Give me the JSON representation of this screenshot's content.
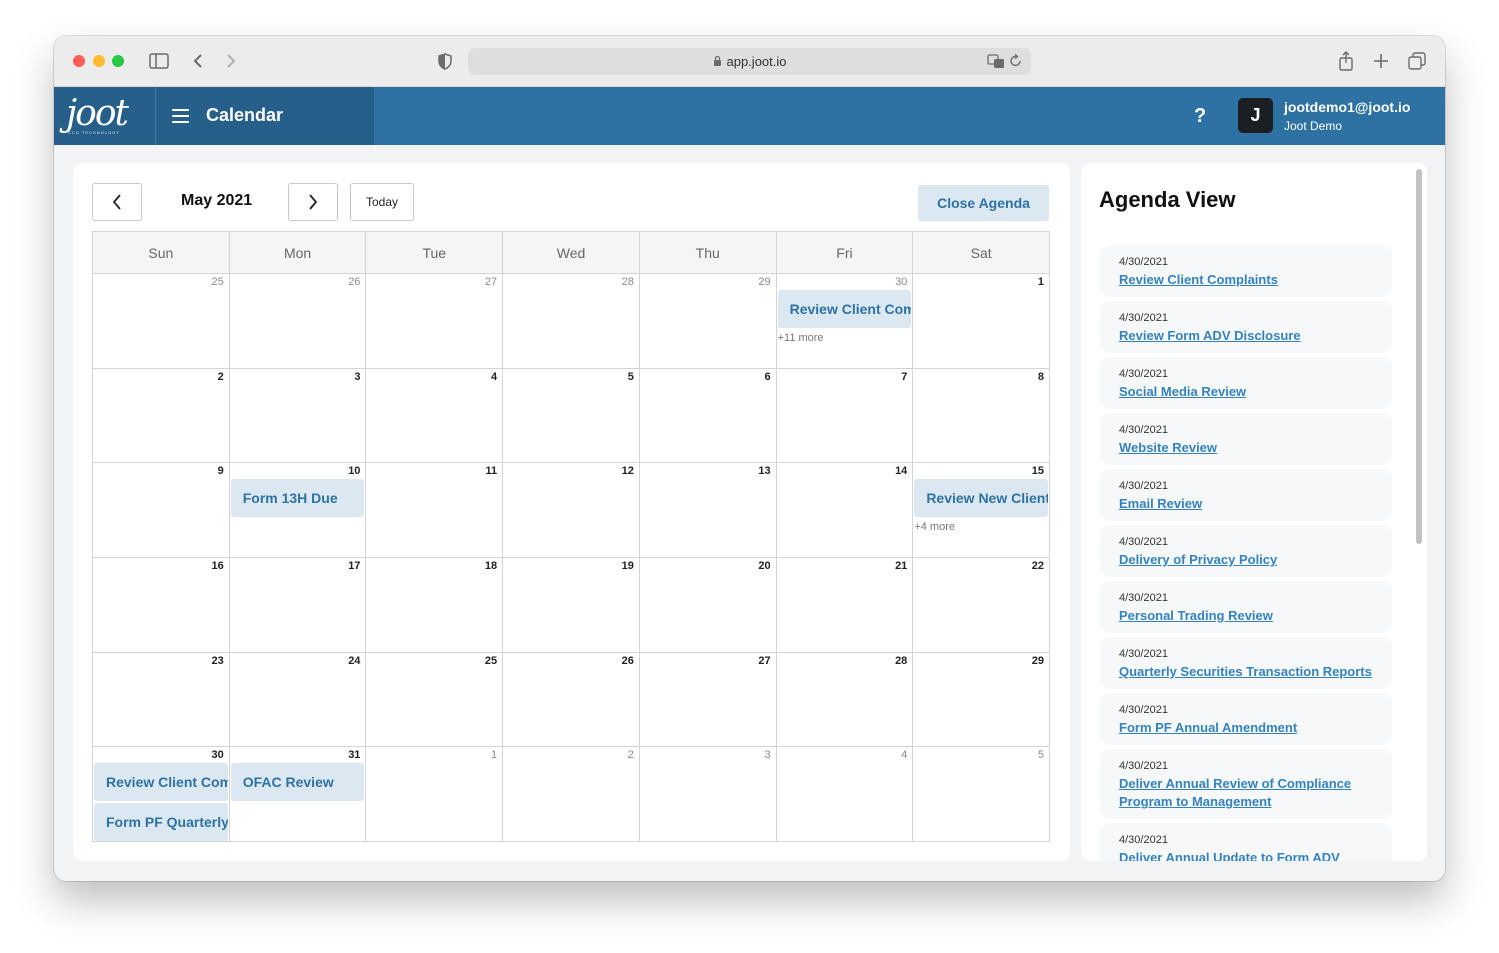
{
  "browser": {
    "url": "app.joot.io"
  },
  "header": {
    "logo_text": "joot",
    "logo_subtext": "CCO TECHNOLOGY",
    "title": "Calendar",
    "help_label": "?",
    "avatar_initial": "J",
    "user_email": "jootdemo1@joot.io",
    "user_name": "Joot Demo"
  },
  "calendar": {
    "month_label": "May 2021",
    "prev_label": "‹",
    "next_label": "›",
    "today_label": "Today",
    "close_agenda_label": "Close Agenda",
    "weekdays": [
      "Sun",
      "Mon",
      "Tue",
      "Wed",
      "Thu",
      "Fri",
      "Sat"
    ],
    "weeks": [
      [
        {
          "num": "25",
          "other": true
        },
        {
          "num": "26",
          "other": true
        },
        {
          "num": "27",
          "other": true
        },
        {
          "num": "28",
          "other": true
        },
        {
          "num": "29",
          "other": true
        },
        {
          "num": "30",
          "other": true,
          "events": [
            "Review Client Complaints"
          ],
          "more": "+11 more"
        },
        {
          "num": "1"
        }
      ],
      [
        {
          "num": "2"
        },
        {
          "num": "3"
        },
        {
          "num": "4"
        },
        {
          "num": "5"
        },
        {
          "num": "6"
        },
        {
          "num": "7"
        },
        {
          "num": "8"
        }
      ],
      [
        {
          "num": "9"
        },
        {
          "num": "10",
          "events": [
            "Form 13H Due"
          ]
        },
        {
          "num": "11"
        },
        {
          "num": "12"
        },
        {
          "num": "13"
        },
        {
          "num": "14"
        },
        {
          "num": "15",
          "events": [
            "Review New Client"
          ],
          "more": "+4 more"
        }
      ],
      [
        {
          "num": "16"
        },
        {
          "num": "17"
        },
        {
          "num": "18"
        },
        {
          "num": "19"
        },
        {
          "num": "20"
        },
        {
          "num": "21"
        },
        {
          "num": "22"
        }
      ],
      [
        {
          "num": "23"
        },
        {
          "num": "24"
        },
        {
          "num": "25"
        },
        {
          "num": "26"
        },
        {
          "num": "27"
        },
        {
          "num": "28"
        },
        {
          "num": "29"
        }
      ],
      [
        {
          "num": "30",
          "events": [
            "Review Client Complaints",
            "Form PF Quarterly"
          ]
        },
        {
          "num": "31",
          "events": [
            "OFAC Review"
          ]
        },
        {
          "num": "1",
          "other": true
        },
        {
          "num": "2",
          "other": true
        },
        {
          "num": "3",
          "other": true
        },
        {
          "num": "4",
          "other": true
        },
        {
          "num": "5",
          "other": true
        }
      ]
    ]
  },
  "agenda": {
    "title": "Agenda View",
    "items": [
      {
        "date": "4/30/2021",
        "label": "Review Client Complaints"
      },
      {
        "date": "4/30/2021",
        "label": "Review Form ADV Disclosure"
      },
      {
        "date": "4/30/2021",
        "label": "Social Media Review"
      },
      {
        "date": "4/30/2021",
        "label": "Website Review"
      },
      {
        "date": "4/30/2021",
        "label": "Email Review"
      },
      {
        "date": "4/30/2021",
        "label": "Delivery of Privacy Policy"
      },
      {
        "date": "4/30/2021",
        "label": "Personal Trading Review"
      },
      {
        "date": "4/30/2021",
        "label": "Quarterly Securities Transaction Reports"
      },
      {
        "date": "4/30/2021",
        "label": "Form PF Annual Amendment"
      },
      {
        "date": "4/30/2021",
        "label": "Deliver Annual Review of Compliance Program to Management"
      },
      {
        "date": "4/30/2021",
        "label": "Deliver Annual Update to Form ADV"
      }
    ]
  },
  "colors": {
    "accent": "#2e72a4",
    "event_bg": "#dbe8f1",
    "link": "#3483c0"
  }
}
